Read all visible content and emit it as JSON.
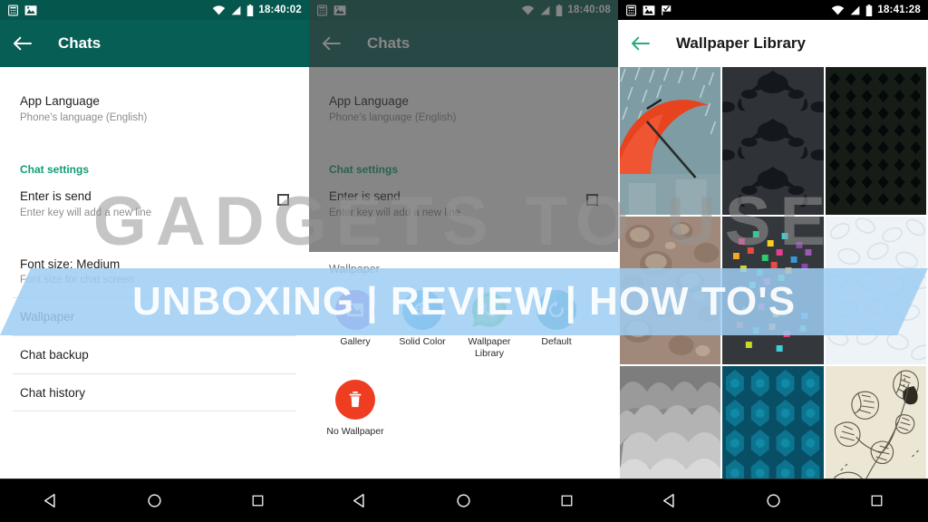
{
  "panels": [
    {
      "id": "chats-settings",
      "statusbar": {
        "time": "18:40:02",
        "icons": [
          "calculator-icon",
          "image-icon",
          "wifi-icon",
          "signal-icon",
          "battery-icon"
        ]
      },
      "appbar": {
        "back": "back-arrow-icon",
        "title": "Chats"
      }
    },
    {
      "id": "wallpaper-chooser",
      "statusbar": {
        "time": "18:40:08",
        "icons": [
          "calculator-icon",
          "image-icon",
          "wifi-icon",
          "signal-icon",
          "battery-icon"
        ]
      },
      "appbar": {
        "back": "back-arrow-icon",
        "title": "Chats"
      }
    },
    {
      "id": "wallpaper-library",
      "statusbar": {
        "time": "18:41:28",
        "icons": [
          "calculator-icon",
          "image-icon",
          "check-flag-icon",
          "wifi-icon",
          "signal-icon",
          "battery-icon"
        ]
      },
      "appbar": {
        "back": "back-arrow-icon",
        "title": "Wallpaper Library"
      }
    }
  ],
  "settings": {
    "app_language": {
      "title": "App Language",
      "subtitle": "Phone's language (English)"
    },
    "section_chat_settings": "Chat settings",
    "enter_is_send": {
      "title": "Enter is send",
      "subtitle": "Enter key will add a new line",
      "checked": false
    },
    "font_size": {
      "title": "Font size: Medium",
      "subtitle": "Font size for chat screen"
    },
    "wallpaper": {
      "title": "Wallpaper"
    },
    "chat_backup": {
      "title": "Chat backup"
    },
    "chat_history": {
      "title": "Chat history"
    }
  },
  "wallpaper_sheet": {
    "title": "Wallpaper",
    "options": [
      {
        "label": "Gallery",
        "icon": "gallery-icon",
        "color": "#9b5fe0"
      },
      {
        "label": "Solid Color",
        "icon": "palette-icon",
        "color": "#1d9ae8"
      },
      {
        "label": "Wallpaper Library",
        "icon": "whatsapp-icon",
        "color": "#4bc959"
      },
      {
        "label": "Default",
        "icon": "refresh-icon",
        "color": "#2196c4"
      }
    ],
    "secondary": [
      {
        "label": "No Wallpaper",
        "icon": "trash-icon",
        "color": "#ef3d22"
      }
    ]
  },
  "wallpaper_library": {
    "thumbnails": [
      {
        "name": "red-umbrella-rain",
        "style": "wp-umbrella"
      },
      {
        "name": "dark-damask-pattern",
        "style": "wp-damask"
      },
      {
        "name": "dark-diamond-lattice",
        "style": "wp-diamond"
      },
      {
        "name": "moon-crater-texture",
        "style": "wp-moon"
      },
      {
        "name": "colorful-squares-dark",
        "style": "wp-squares"
      },
      {
        "name": "light-floral-pattern",
        "style": "wp-floral"
      },
      {
        "name": "grey-cloud-scallops",
        "style": "wp-clouds"
      },
      {
        "name": "teal-hexagon-pattern",
        "style": "wp-hex"
      },
      {
        "name": "cream-botanical-leaves",
        "style": "wp-leaves"
      }
    ]
  },
  "navbar": {
    "back": "nav-back-icon",
    "home": "nav-home-icon",
    "recents": "nav-recents-icon"
  },
  "watermark": {
    "top": "GADGETS TO USE",
    "band": "UNBOXING | REVIEW | HOW TO'S"
  },
  "colors": {
    "header_teal": "#075e54",
    "accent_green": "#0f9d76",
    "banner_blue": "#9ecdf2"
  }
}
